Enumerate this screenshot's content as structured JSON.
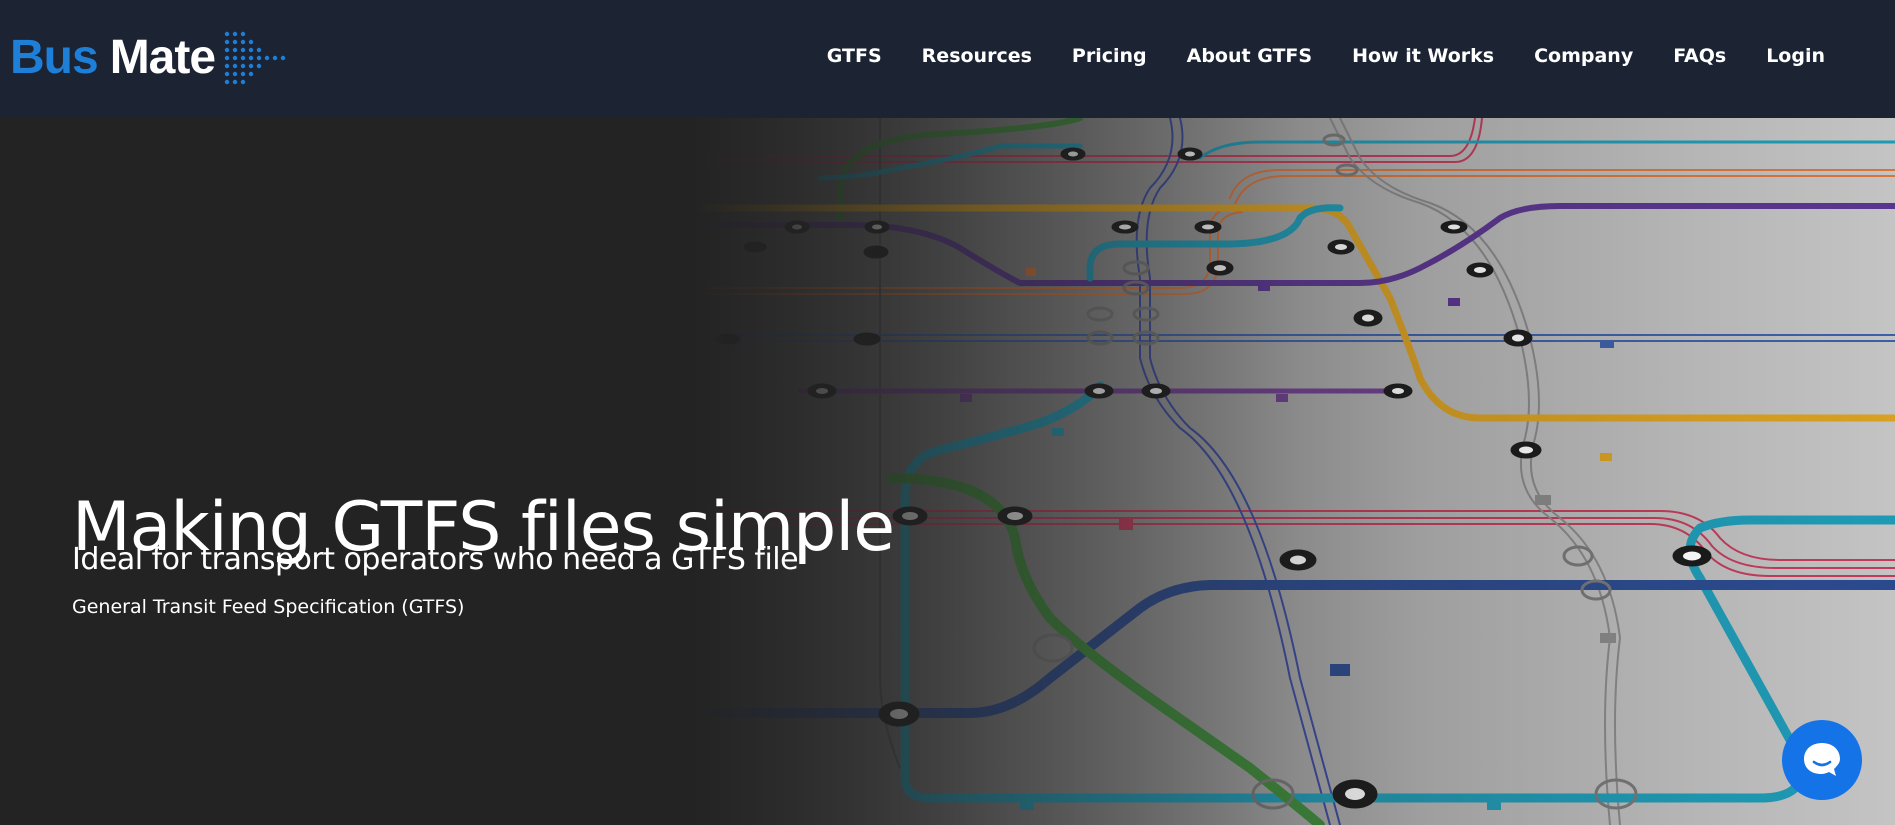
{
  "brand": {
    "part1": "Bus",
    "part2": "Mate",
    "accent": "#1e7fd8",
    "header_bg": "#1c2433"
  },
  "nav": [
    {
      "label": "GTFS"
    },
    {
      "label": "Resources"
    },
    {
      "label": "Pricing"
    },
    {
      "label": "About GTFS"
    },
    {
      "label": "How it Works"
    },
    {
      "label": "Company"
    },
    {
      "label": "FAQs"
    },
    {
      "label": "Login"
    }
  ],
  "hero": {
    "title": "Making GTFS files simple",
    "subtitle": "Ideal for transport operators who need a GTFS file",
    "tagline": "General Transit Feed Specification (GTFS)",
    "background_icon": "transit-map-illustration"
  },
  "chat": {
    "icon": "chat-bubble-icon",
    "color": "#1473e6"
  }
}
